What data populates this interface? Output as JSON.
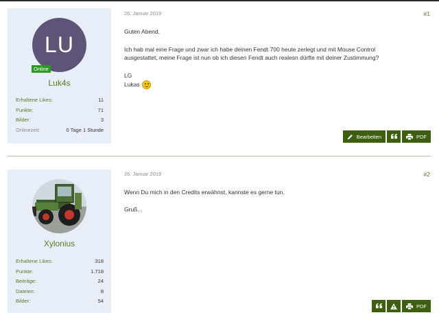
{
  "posts": [
    {
      "user": {
        "avatar_initials": "LU",
        "avatar_color": "#5e5478",
        "online_badge": "Online",
        "username": "Luk4s",
        "stats": [
          {
            "label": "Erhaltene Likes:",
            "value": "11"
          },
          {
            "label": "Punkte:",
            "value": "71"
          },
          {
            "label": "Bilder:",
            "value": "3"
          },
          {
            "label": "Onlinezeit:",
            "value": "0 Tage 1 Stunde"
          }
        ]
      },
      "date": "26. Januar 2019",
      "permalink": "#1",
      "lines": [
        "Guten Abend,",
        "Ich hab mal eine Frage und zwar ich habe deinen Fendt 700 heute zerlegt und mit Mouse Control",
        "ausgestattet, meine Frage ist nun ob ich diesen Fendt auch realesn dürfte mit deiner Zustimmung?",
        "LG",
        "Lukas"
      ],
      "buttons": {
        "edit": "Bearbeiten",
        "pdf": "PDF"
      }
    },
    {
      "user": {
        "avatar_icon": "tractor-avatar-photo",
        "username": "Xylonius",
        "stats": [
          {
            "label": "Erhaltene Likes:",
            "value": "318"
          },
          {
            "label": "Punkte:",
            "value": "1.718"
          },
          {
            "label": "Beiträge:",
            "value": "24"
          },
          {
            "label": "Dateien:",
            "value": "8"
          },
          {
            "label": "Bilder:",
            "value": "54"
          }
        ]
      },
      "date": "26. Januar 2019",
      "permalink": "#2",
      "lines": [
        "Wenn Du mich in den Credits erwähnst, kannste es gerne tun.",
        "Gruß..."
      ],
      "buttons": {
        "pdf": "PDF"
      }
    }
  ],
  "colors": {
    "accent_green": "#3f5f10",
    "username_green": "#5a7a2a",
    "panel_bg": "#e8eef7",
    "online_green": "#2e9a1f"
  }
}
